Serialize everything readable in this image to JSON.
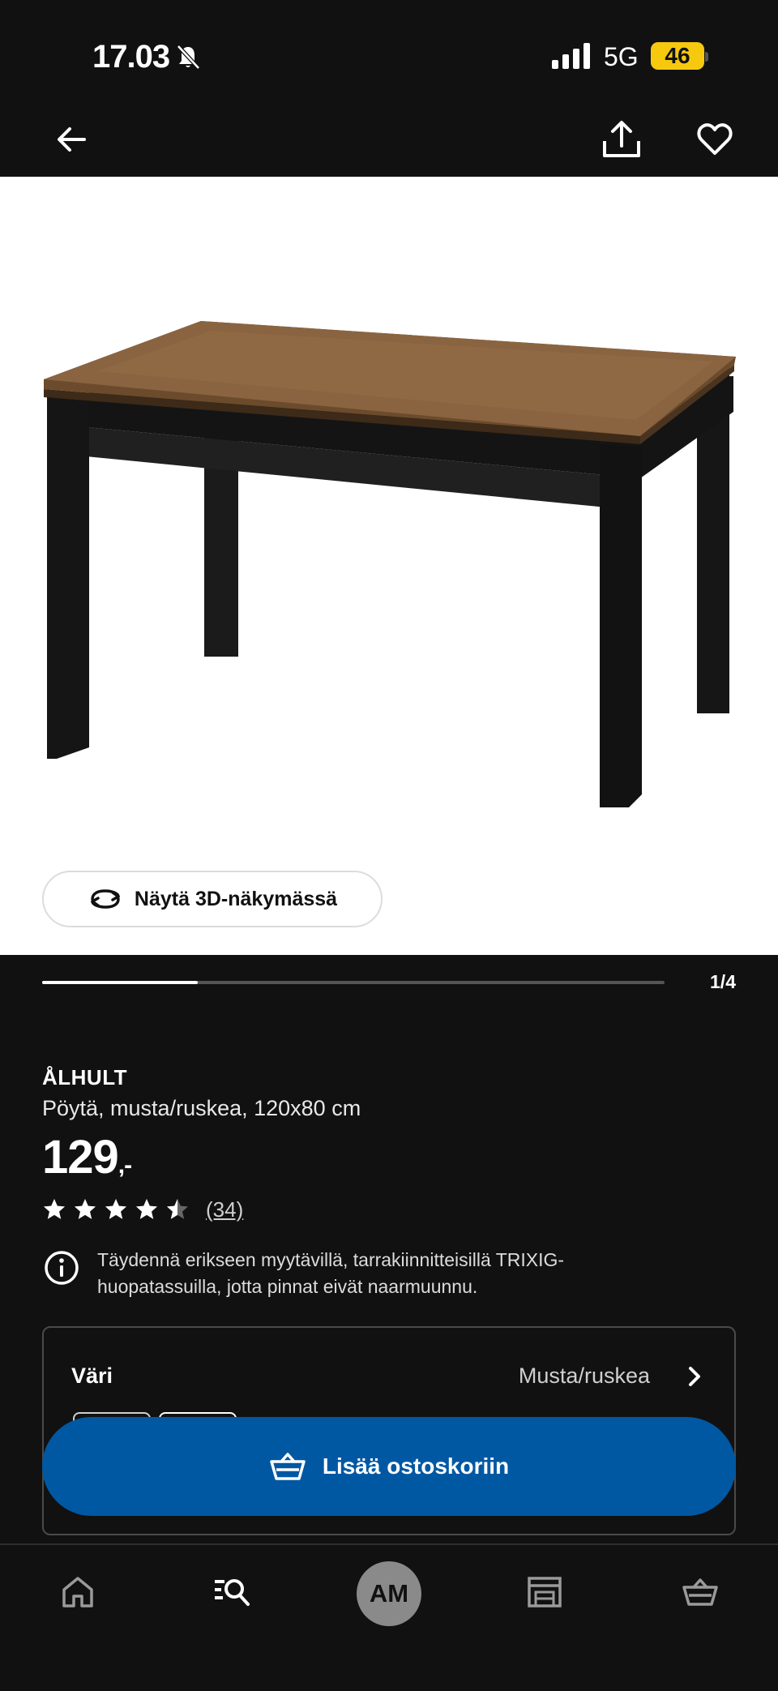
{
  "status_bar": {
    "time": "17.03",
    "network": "5G",
    "battery": "46"
  },
  "product_gallery": {
    "view_3d_label": "Näytä 3D-näkymässä",
    "page_counter": "1/4",
    "progress_fraction": 0.25
  },
  "product": {
    "name": "ÅLHULT",
    "description": "Pöytä, musta/ruskea, 120x80 cm",
    "price": "129",
    "price_suffix": ",-",
    "rating": 4.5,
    "review_count": "(34)"
  },
  "info_note": {
    "text": "Täydennä erikseen myytävillä, tarrakiinnitteisillä TRIXIG-huopatassuilla, jotta pinnat eivät naarmuunnu."
  },
  "variant": {
    "label": "Väri",
    "value": "Musta/ruskea"
  },
  "cart_button": {
    "label": "Lisää ostoskoriin"
  },
  "bottom_nav": {
    "profile_initials": "AM"
  },
  "colors": {
    "background": "#111111",
    "primary_button": "#0058a3",
    "battery": "#f6c90e"
  }
}
